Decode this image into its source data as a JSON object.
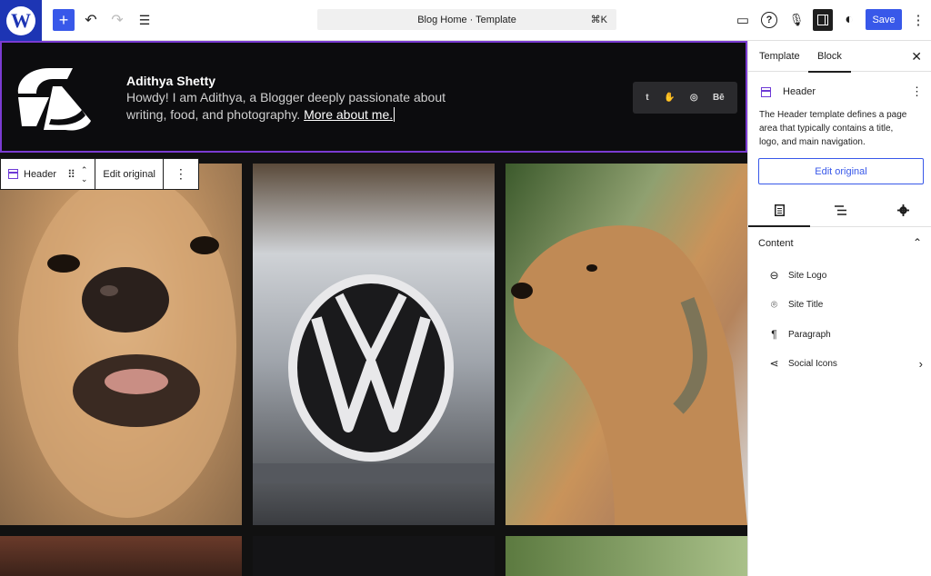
{
  "topbar": {
    "logo_letter": "W",
    "add": "+",
    "undo": "↶",
    "redo": "↷",
    "outline": "☰",
    "command_label": "Blog Home · Template",
    "command_shortcut": "⌘K",
    "view": "▭",
    "help": "?",
    "mic": "🎙",
    "styles": "◐",
    "save_label": "Save",
    "more": "⋮"
  },
  "header_block": {
    "site_title": "Adithya Shetty",
    "tagline_text": "Howdy! I am Adithya, a Blogger deeply passionate about writing, food, and photography. ",
    "tagline_link": "More about me.",
    "social_icons": [
      "t",
      "✋",
      "◎",
      "Bē"
    ]
  },
  "block_toolbar": {
    "block_label": "Header",
    "drag": "⠿",
    "move_up": "⌃",
    "move_down": "⌄",
    "edit_original": "Edit original",
    "options": "⋮"
  },
  "sidebar": {
    "tabs": [
      "Template",
      "Block"
    ],
    "active_tab": "Block",
    "close": "✕",
    "block_name": "Header",
    "block_menu": "⋮",
    "block_description": "The Header template defines a page area that typically contains a title, logo, and main navigation.",
    "edit_original": "Edit original",
    "content_heading": "Content",
    "content_chevron": "⌃",
    "content_items": [
      {
        "label": "Site Logo",
        "icon": "site-logo-icon",
        "glyph": "⊖"
      },
      {
        "label": "Site Title",
        "icon": "map-pin-icon",
        "glyph": "⌾"
      },
      {
        "label": "Paragraph",
        "icon": "paragraph-icon",
        "glyph": "¶"
      },
      {
        "label": "Social Icons",
        "icon": "share-icon",
        "glyph": "⋖"
      }
    ],
    "expand": "›"
  },
  "colors": {
    "accent": "#3858e9",
    "wp_blue": "#1d35b4",
    "selection": "#7a3bd1"
  }
}
